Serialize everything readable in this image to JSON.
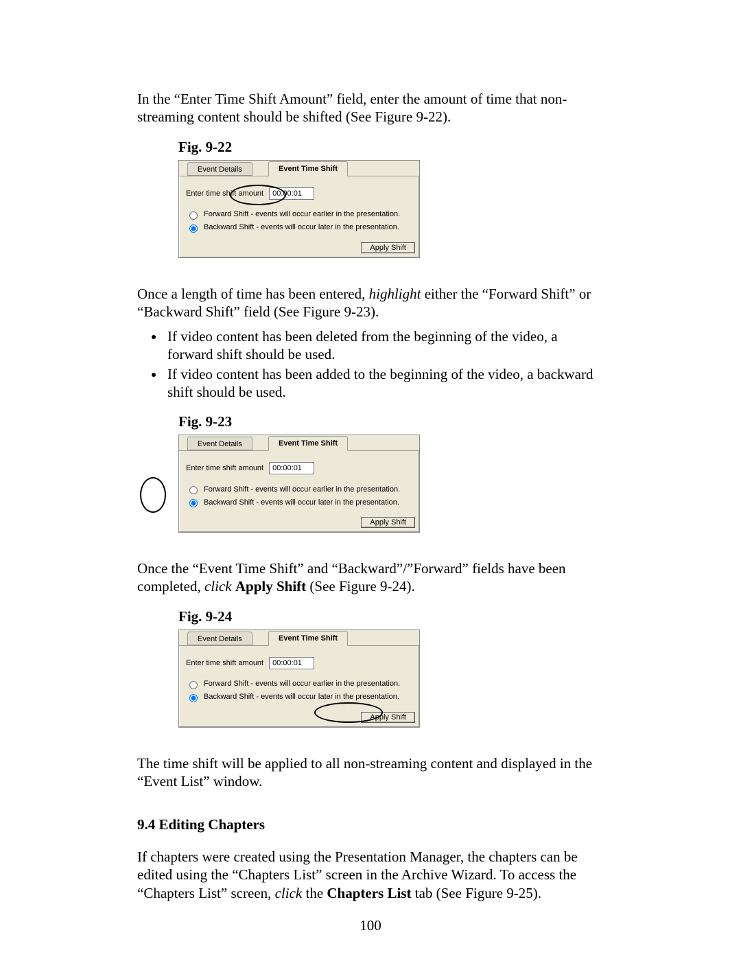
{
  "para1": "In the “Enter Time Shift Amount” field, enter the amount of time that non-streaming content should be shifted (See Figure 9-22).",
  "fig22_label": "Fig. 9-22",
  "fig23_label": "Fig. 9-23",
  "fig24_label": "Fig.  9-24",
  "para2_a": "Once a length of time has been entered, ",
  "para2_b": "highlight",
  "para2_c": " either the “Forward Shift” or “Backward Shift” field (See Figure 9-23).",
  "bullet1": "If video content has been deleted from the beginning of the video, a forward shift should be used.",
  "bullet2": "If video content has been added to the beginning of the video, a backward shift should be used.",
  "para3_a": "Once the “Event Time Shift” and “Backward”/”Forward” fields have been completed, ",
  "para3_b": "click",
  "para3_c": " ",
  "para3_d": "Apply Shift",
  "para3_e": " (See Figure 9-24).",
  "para4": "The time shift will be applied to all non-streaming content and displayed in the “Event List” window.",
  "section_heading": "9.4  Editing Chapters",
  "para5_a": "If chapters were created using the Presentation Manager, the chapters can be edited using the “Chapters List” screen in the Archive Wizard.  To access the “Chapters List” screen, ",
  "para5_b": "click",
  "para5_c": " the ",
  "para5_d": "Chapters List",
  "para5_e": " tab (See Figure 9-25).",
  "page_number": "100",
  "shot": {
    "tab_inactive": "Event Details",
    "tab_active": "Event Time Shift",
    "field_label": "Enter time shift amount",
    "field_value": "00:00:01",
    "radio_forward": "Forward Shift - events will occur earlier in the presentation.",
    "radio_backward": "Backward Shift - events will occur later in the presentation.",
    "apply_button": "Apply Shift"
  }
}
